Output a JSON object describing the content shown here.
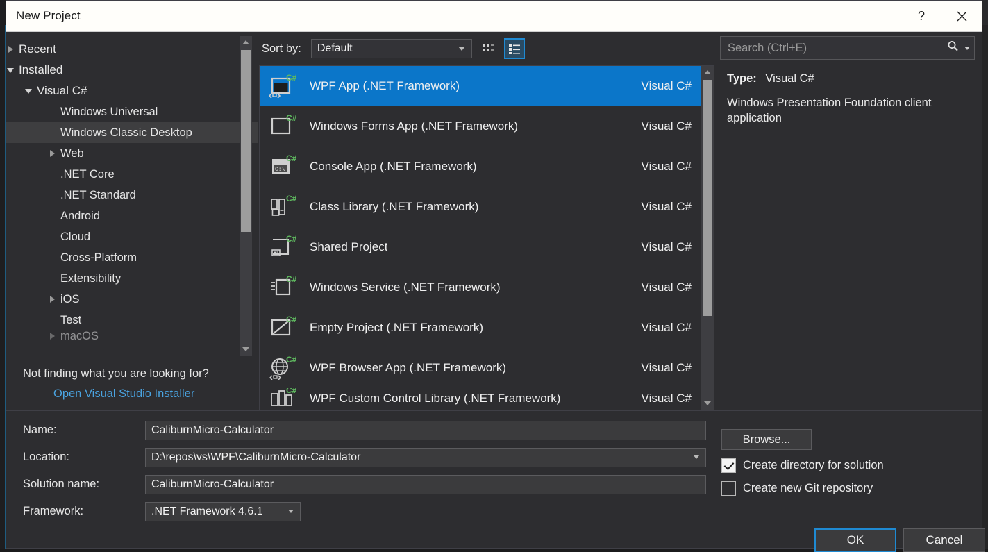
{
  "window": {
    "title": "New Project",
    "help_icon": "help-question-icon",
    "help_label": "?",
    "close_icon": "close-icon"
  },
  "tree": {
    "items": [
      {
        "label": "Recent",
        "level": 0,
        "expander": "collapsed",
        "selected": false
      },
      {
        "label": "Installed",
        "level": 0,
        "expander": "expanded",
        "selected": false
      },
      {
        "label": "Visual C#",
        "level": 1,
        "expander": "expanded",
        "selected": false
      },
      {
        "label": "Windows Universal",
        "level": 2,
        "expander": "none",
        "selected": false
      },
      {
        "label": "Windows Classic Desktop",
        "level": 2,
        "expander": "none",
        "selected": true
      },
      {
        "label": "Web",
        "level": 2,
        "expander": "collapsed",
        "selected": false
      },
      {
        "label": ".NET Core",
        "level": 2,
        "expander": "none",
        "selected": false
      },
      {
        "label": ".NET Standard",
        "level": 2,
        "expander": "none",
        "selected": false
      },
      {
        "label": "Android",
        "level": 2,
        "expander": "none",
        "selected": false
      },
      {
        "label": "Cloud",
        "level": 2,
        "expander": "none",
        "selected": false
      },
      {
        "label": "Cross-Platform",
        "level": 2,
        "expander": "none",
        "selected": false
      },
      {
        "label": "Extensibility",
        "level": 2,
        "expander": "none",
        "selected": false
      },
      {
        "label": "iOS",
        "level": 2,
        "expander": "collapsed",
        "selected": false
      },
      {
        "label": "Test",
        "level": 2,
        "expander": "none",
        "selected": false
      },
      {
        "label": "macOS",
        "level": 2,
        "expander": "collapsed",
        "selected": false,
        "partial": true
      }
    ],
    "footer_question": "Not finding what you are looking for?",
    "footer_link": "Open Visual Studio Installer"
  },
  "toolbar": {
    "sort_label": "Sort by:",
    "sort_value": "Default",
    "tile_view_icon": "grid-view-icon",
    "list_view_icon": "list-view-icon",
    "active_view": "list"
  },
  "search": {
    "placeholder": "Search (Ctrl+E)",
    "value": "",
    "icon": "search-magnifier-icon"
  },
  "templates": {
    "rows": [
      {
        "name": "WPF App (.NET Framework)",
        "lang": "Visual C#",
        "icon": "wpf-app-icon",
        "selected": true
      },
      {
        "name": "Windows Forms App (.NET Framework)",
        "lang": "Visual C#",
        "icon": "winforms-app-icon",
        "selected": false
      },
      {
        "name": "Console App (.NET Framework)",
        "lang": "Visual C#",
        "icon": "console-app-icon",
        "selected": false
      },
      {
        "name": "Class Library (.NET Framework)",
        "lang": "Visual C#",
        "icon": "class-library-icon",
        "selected": false
      },
      {
        "name": "Shared Project",
        "lang": "Visual C#",
        "icon": "shared-project-icon",
        "selected": false
      },
      {
        "name": "Windows Service (.NET Framework)",
        "lang": "Visual C#",
        "icon": "windows-service-icon",
        "selected": false
      },
      {
        "name": "Empty Project (.NET Framework)",
        "lang": "Visual C#",
        "icon": "empty-project-icon",
        "selected": false
      },
      {
        "name": "WPF Browser App (.NET Framework)",
        "lang": "Visual C#",
        "icon": "wpf-browser-app-icon",
        "selected": false
      },
      {
        "name": "WPF Custom Control Library (.NET Framework)",
        "lang": "Visual C#",
        "icon": "wpf-custom-control-icon",
        "selected": false,
        "clipped": true
      }
    ]
  },
  "info": {
    "type_label": "Type:",
    "type_value": "Visual C#",
    "description": "Windows Presentation Foundation client application"
  },
  "form": {
    "name_label": "Name:",
    "name_value": "CaliburnMicro-Calculator",
    "location_label": "Location:",
    "location_value": "D:\\repos\\vs\\WPF\\CaliburnMicro-Calculator",
    "solution_label": "Solution name:",
    "solution_value": "CaliburnMicro-Calculator",
    "framework_label": "Framework:",
    "framework_value": ".NET Framework 4.6.1",
    "browse_label": "Browse...",
    "create_directory_label": "Create directory for solution",
    "create_directory_checked": true,
    "create_git_label": "Create new Git repository",
    "create_git_checked": false
  },
  "buttons": {
    "ok_label": "OK",
    "cancel_label": "Cancel"
  },
  "colors": {
    "selection_blue": "#0b76c9",
    "accent_blue": "#1f8ad2",
    "link_blue": "#4aa3e0",
    "csharp_green": "#5fb95f",
    "dialog_bg": "#2d2d30",
    "titlebar_bg": "#fffefa"
  }
}
